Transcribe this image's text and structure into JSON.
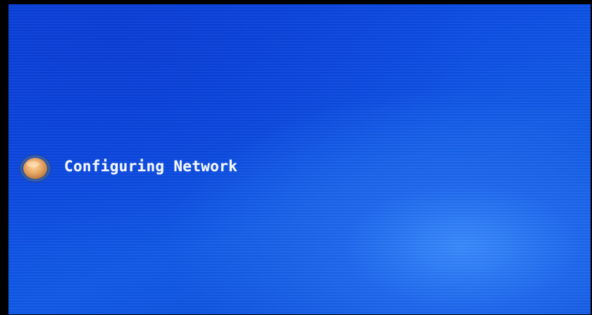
{
  "boot_screen": {
    "status_text": "Configuring Network",
    "status_icon": "progress-orb-icon"
  },
  "colors": {
    "background": "#0d4fe6",
    "text": "#f2f6ff",
    "orb_fill": "#e8a868",
    "orb_ring": "#8fb4e8"
  }
}
